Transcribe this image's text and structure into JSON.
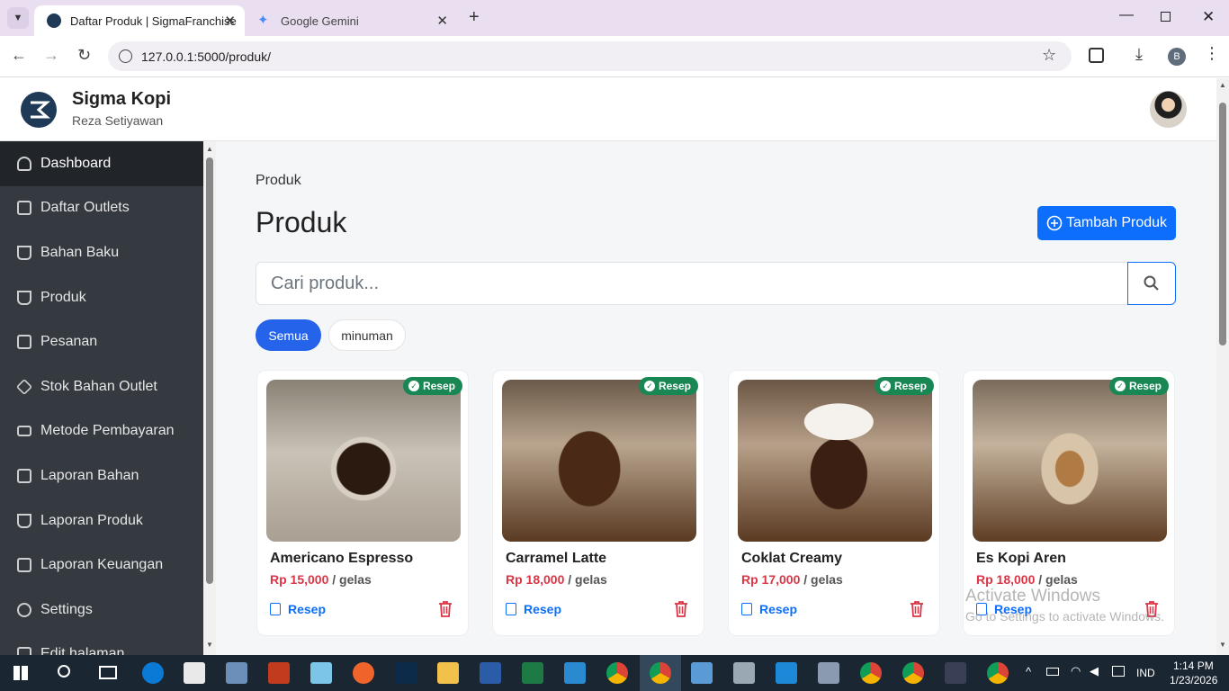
{
  "browser": {
    "tabs": [
      {
        "title": "Daftar Produk | SigmaFranchise",
        "active": true
      },
      {
        "title": "Google Gemini",
        "active": false
      }
    ],
    "url": "127.0.0.1:5000/produk/",
    "profile_initial": "B"
  },
  "app": {
    "brand": "Sigma Kopi",
    "owner": "Reza Setiyawan"
  },
  "sidebar": {
    "items": [
      {
        "label": "Dashboard",
        "icon": "speedometer-icon",
        "active": true
      },
      {
        "label": "Daftar Outlets",
        "icon": "shop-icon"
      },
      {
        "label": "Bahan Baku",
        "icon": "basket-icon"
      },
      {
        "label": "Produk",
        "icon": "cup-icon"
      },
      {
        "label": "Pesanan",
        "icon": "receipt-icon"
      },
      {
        "label": "Stok Bahan Outlet",
        "icon": "box-icon"
      },
      {
        "label": "Metode Pembayaran",
        "icon": "credit-card-icon"
      },
      {
        "label": "Laporan Bahan",
        "icon": "clipboard-icon"
      },
      {
        "label": "Laporan Produk",
        "icon": "cup-icon"
      },
      {
        "label": "Laporan Keuangan",
        "icon": "wallet-icon"
      },
      {
        "label": "Settings",
        "icon": "gear-icon"
      },
      {
        "label": "Edit halaman",
        "icon": "pencil-icon"
      }
    ]
  },
  "main": {
    "breadcrumb": "Produk",
    "title": "Produk",
    "add_button": "Tambah Produk",
    "search_placeholder": "Cari produk...",
    "filters": [
      "Semua",
      "minuman"
    ],
    "badge_label": "Resep",
    "recipe_link": "Resep",
    "unit": "/ gelas",
    "products": [
      {
        "name": "Americano Espresso",
        "price": "Rp 15,000"
      },
      {
        "name": "Carramel Latte",
        "price": "Rp 18,000"
      },
      {
        "name": "Coklat Creamy",
        "price": "Rp 17,000"
      },
      {
        "name": "Es Kopi Aren",
        "price": "Rp 18,000"
      }
    ]
  },
  "watermark": {
    "line1": "Activate Windows",
    "line2": "Go to Settings to activate Windows."
  },
  "taskbar": {
    "lang": "IND",
    "time": "1:14 PM",
    "date": "1/23/2026"
  }
}
